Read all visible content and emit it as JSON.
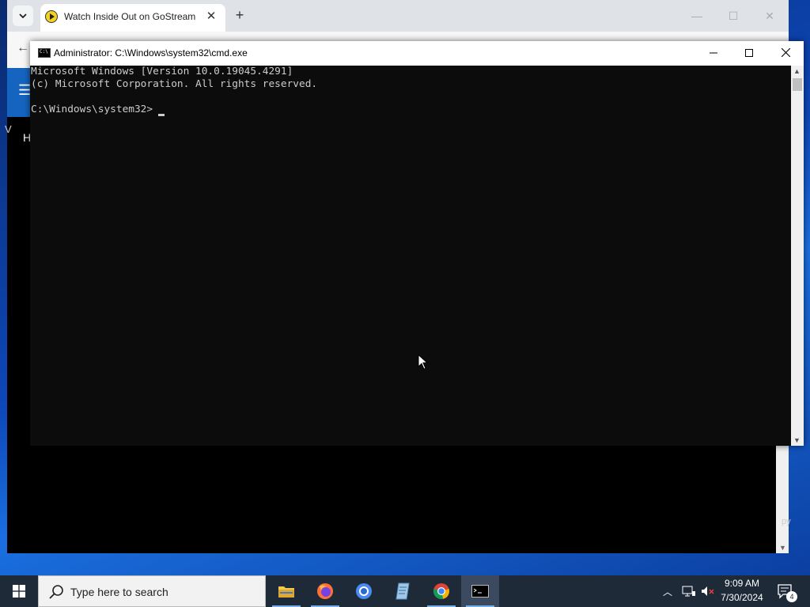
{
  "browser": {
    "tab_title": "Watch Inside Out on GoStream",
    "page_letter_h": "H",
    "page_letter_v": "V",
    "page_py": "py"
  },
  "cmd": {
    "title": "Administrator: C:\\Windows\\system32\\cmd.exe",
    "lines": [
      "Microsoft Windows [Version 10.0.19045.4291]",
      "(c) Microsoft Corporation. All rights reserved.",
      "",
      "C:\\Windows\\system32>"
    ]
  },
  "taskbar": {
    "search_placeholder": "Type here to search",
    "apps": [
      "file-explorer-icon",
      "firefox-icon",
      "chromium-icon",
      "notes-icon",
      "chrome-icon",
      "cmd-icon"
    ],
    "time": "9:09 AM",
    "date": "7/30/2024",
    "notification_count": "4"
  },
  "colors": {
    "console_bg": "#0c0c0c",
    "console_text": "#cccccc",
    "taskbar_bg": "#1f2a38",
    "accent": "#78aee8"
  }
}
